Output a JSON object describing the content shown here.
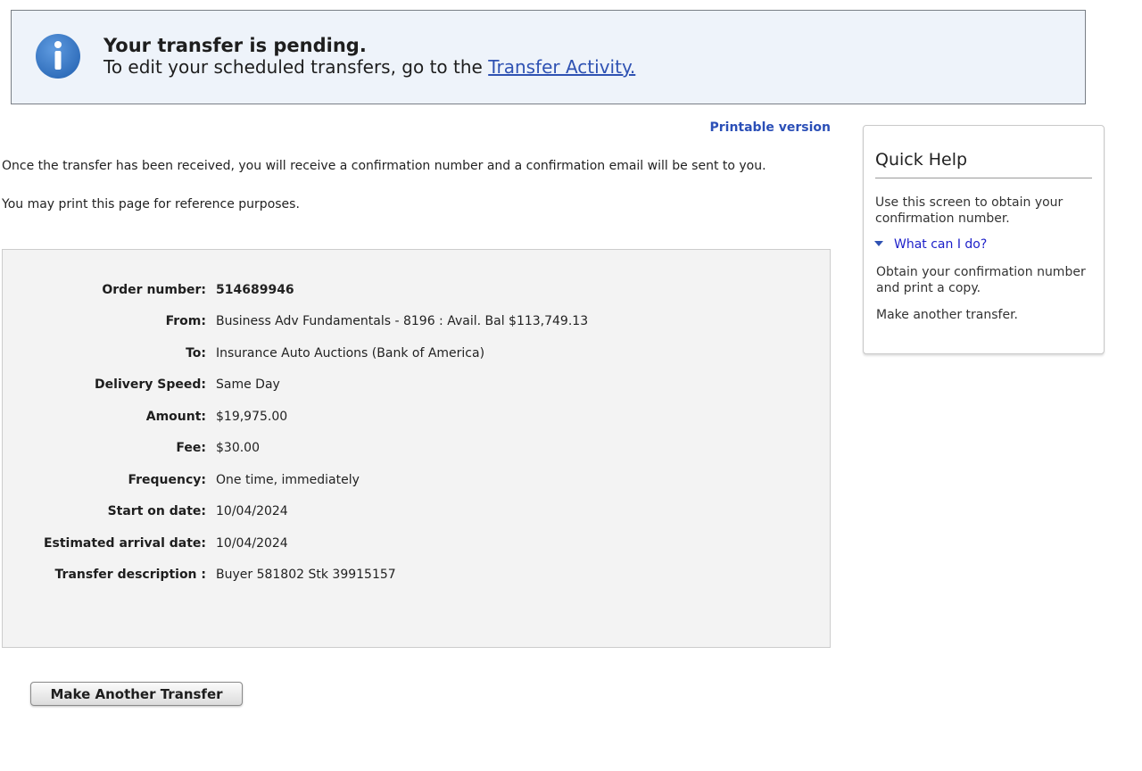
{
  "banner": {
    "title": "Your transfer is pending.",
    "message": "To edit your scheduled transfers, go to the ",
    "link_text": "Transfer Activity."
  },
  "printable_link": "Printable version",
  "paragraphs": [
    "Once the transfer has been received, you will receive a confirmation number and a confirmation email will be sent to you.",
    "You may print this page for reference purposes."
  ],
  "details": [
    {
      "label": "Order number:",
      "value": "514689946"
    },
    {
      "label": "From:",
      "value": "Business Adv Fundamentals - 8196 : Avail. Bal $113,749.13"
    },
    {
      "label": "To:",
      "value": "Insurance Auto Auctions (Bank of America)"
    },
    {
      "label": "Delivery Speed:",
      "value": "Same Day"
    },
    {
      "label": "Amount:",
      "value": "$19,975.00"
    },
    {
      "label": "Fee:",
      "value": "$30.00"
    },
    {
      "label": "Frequency:",
      "value": "One time, immediately"
    },
    {
      "label": "Start on date:",
      "value": "10/04/2024"
    },
    {
      "label": "Estimated arrival date:",
      "value": "10/04/2024"
    },
    {
      "label": "Transfer description :",
      "value": "Buyer 581802 Stk 39915157"
    }
  ],
  "buttons": {
    "make_another": "Make Another Transfer"
  },
  "quick_help": {
    "title": "Quick Help",
    "intro": "Use this screen to obtain your confirmation number.",
    "link": "What can I do?",
    "items": [
      "Obtain your confirmation number and print a copy.",
      "Make another transfer."
    ]
  },
  "colors": {
    "banner_bg": "#eef3fa",
    "link_blue": "#2b4fb7",
    "info_icon": "#3a78c9",
    "details_bg": "#f3f3f3"
  },
  "icons": {
    "banner": "info-icon",
    "quick_help_toggle": "caret-down-icon"
  }
}
